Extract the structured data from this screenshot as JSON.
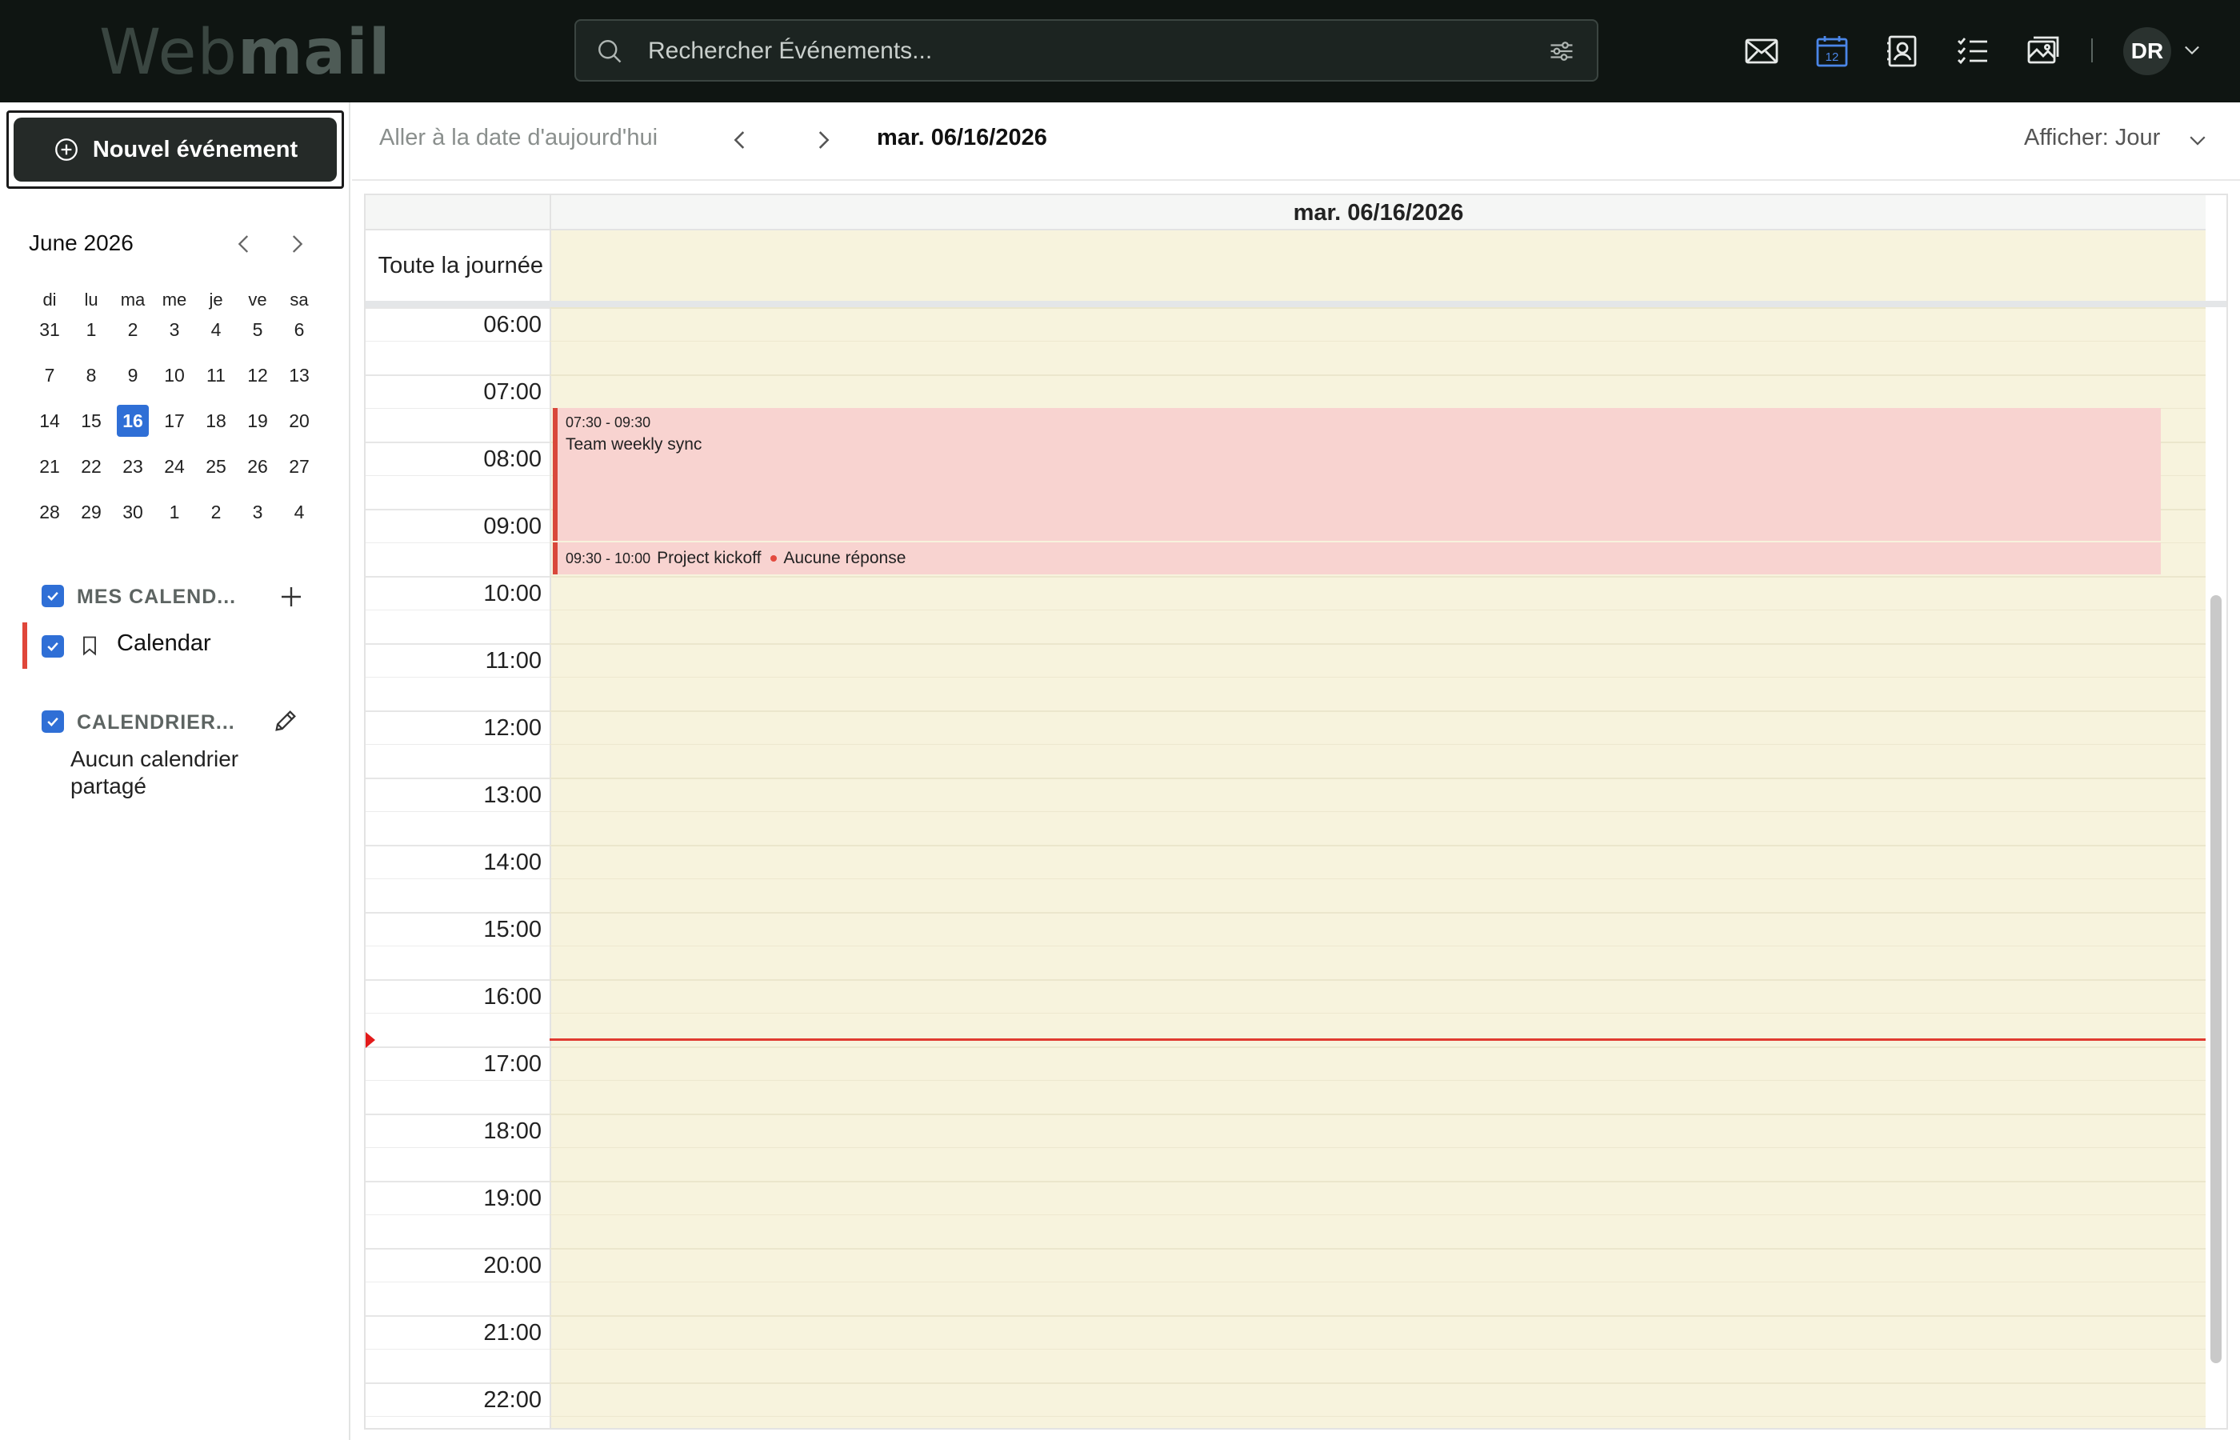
{
  "app": {
    "logo_web": "Web",
    "logo_mail": "mail"
  },
  "search": {
    "placeholder": "Rechercher Événements..."
  },
  "topnav": {
    "icons": [
      "mail-icon",
      "calendar-icon",
      "contacts-icon",
      "tasks-icon",
      "photos-icon"
    ],
    "calendar_day": "12",
    "active_color": "#2f6fd6",
    "avatar_initials": "DR"
  },
  "sidebar": {
    "new_event_label": "Nouvel événement",
    "mini_calendar": {
      "month_title": "June 2026",
      "weekdays": [
        "di",
        "lu",
        "ma",
        "me",
        "je",
        "ve",
        "sa"
      ],
      "weeks": [
        [
          "31",
          "1",
          "2",
          "3",
          "4",
          "5",
          "6"
        ],
        [
          "7",
          "8",
          "9",
          "10",
          "11",
          "12",
          "13"
        ],
        [
          "14",
          "15",
          "16",
          "17",
          "18",
          "19",
          "20"
        ],
        [
          "21",
          "22",
          "23",
          "24",
          "25",
          "26",
          "27"
        ],
        [
          "28",
          "29",
          "30",
          "1",
          "2",
          "3",
          "4"
        ]
      ],
      "today": "16"
    },
    "my_calendars": {
      "title": "MES CALEND...",
      "checked": true,
      "items": [
        {
          "label": "Calendar",
          "color": "#e0463a",
          "checked": true
        }
      ]
    },
    "shared_calendars": {
      "title": "CALENDRIER...",
      "checked": true,
      "empty_text": "Aucun calendrier partagé"
    }
  },
  "toolbar": {
    "today_link": "Aller à la date d'aujourd'hui",
    "current_date": "mar. 06/16/2026",
    "view_label": "Afficher: Jour"
  },
  "day_view": {
    "column_header": "mar. 06/16/2026",
    "allday_label": "Toute la journée",
    "hours": [
      "06:00",
      "07:00",
      "08:00",
      "09:00",
      "10:00",
      "11:00",
      "12:00",
      "13:00",
      "14:00",
      "15:00",
      "16:00",
      "17:00",
      "18:00",
      "19:00",
      "20:00",
      "21:00",
      "22:00"
    ],
    "events": [
      {
        "time": "07:30 - 09:30",
        "title": "Team weekly sync",
        "color": "#f8d3d0",
        "accent": "#d9483b"
      },
      {
        "time": "09:30 - 10:00",
        "title": "Project kickoff",
        "status": "Aucune réponse",
        "color": "#f8d3d0",
        "accent": "#d9483b"
      }
    ]
  }
}
